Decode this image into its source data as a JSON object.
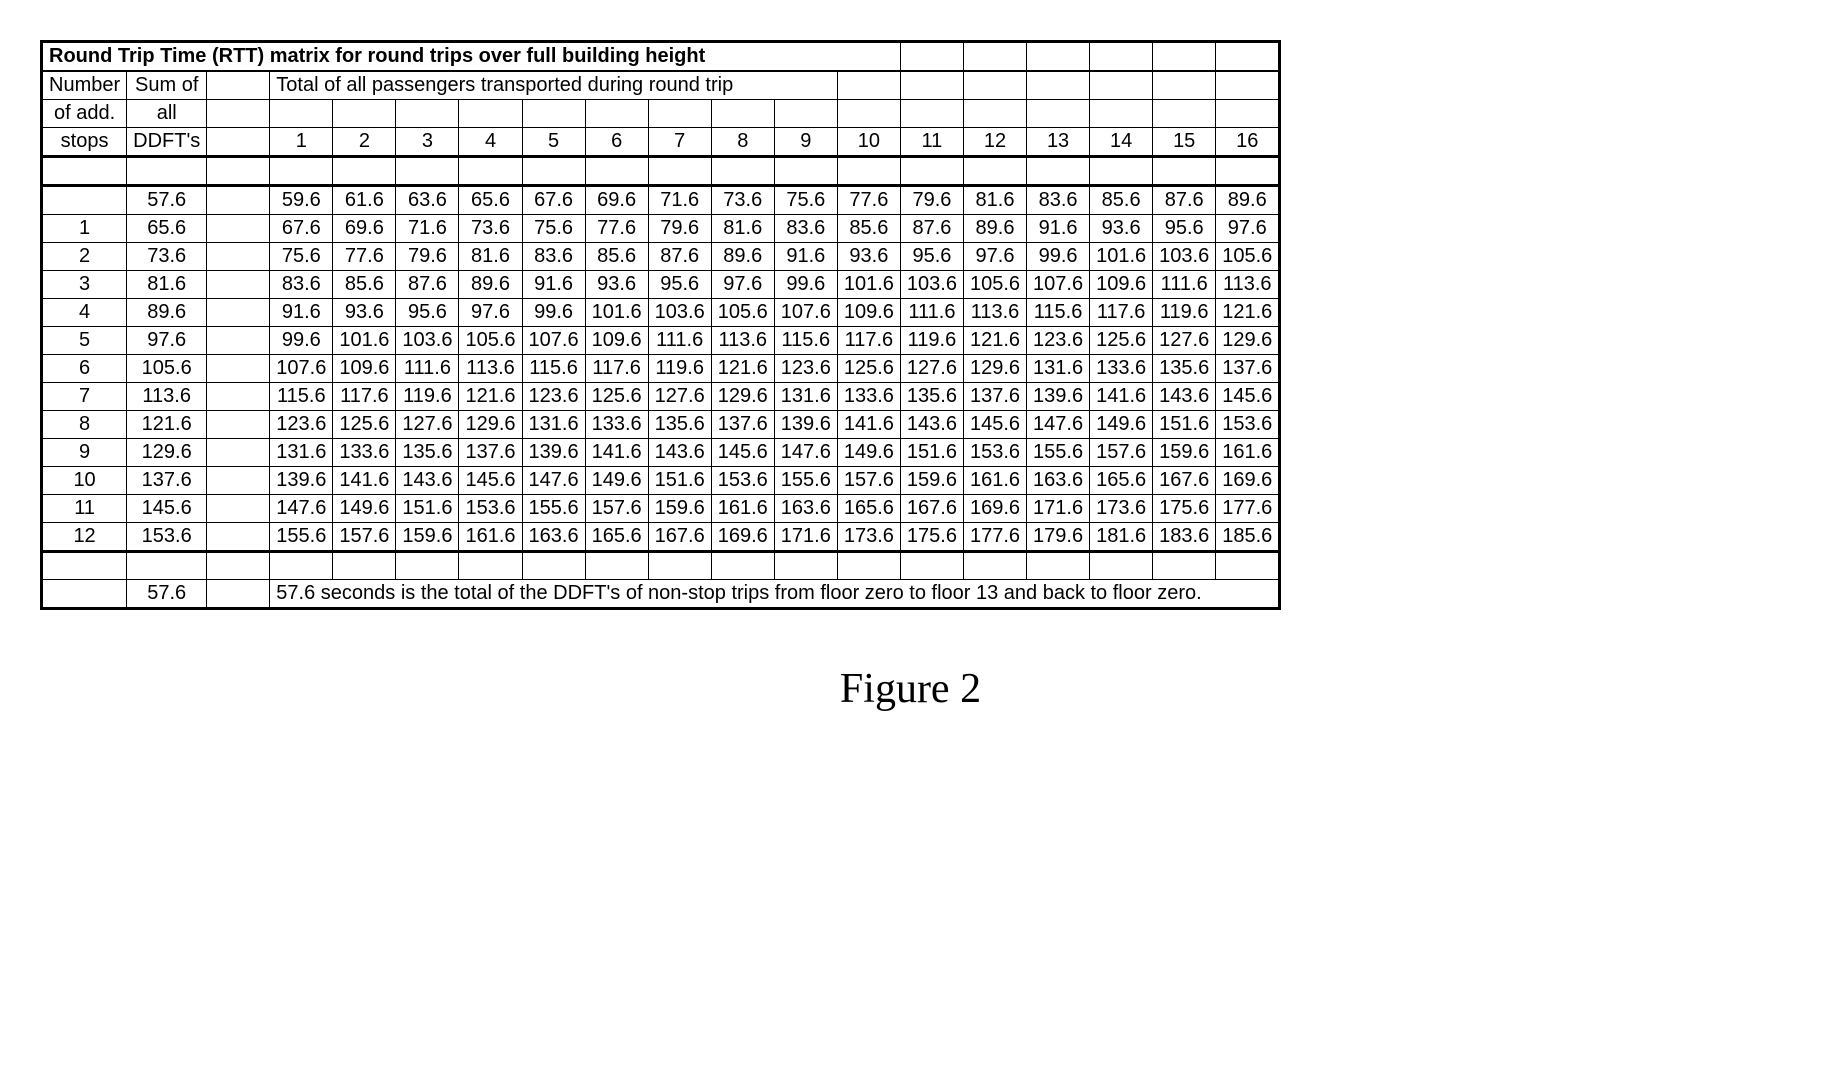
{
  "chart_data": {
    "type": "table",
    "title": "Round Trip Time (RTT) matrix for round trips over full building height",
    "col_header_1": "Number",
    "col_header_2": "Sum of",
    "col_header_3": "Total of all passengers transported during round trip",
    "col_sub_1": "of add.",
    "col_sub_2": "all",
    "col_sub_3": "stops",
    "col_sub_4": "DDFT's",
    "passenger_cols": [
      "1",
      "2",
      "3",
      "4",
      "5",
      "6",
      "7",
      "8",
      "9",
      "10",
      "11",
      "12",
      "13",
      "14",
      "15",
      "16"
    ],
    "rows": [
      {
        "stops": "",
        "ddft": "57.6",
        "vals": [
          "59.6",
          "61.6",
          "63.6",
          "65.6",
          "67.6",
          "69.6",
          "71.6",
          "73.6",
          "75.6",
          "77.6",
          "79.6",
          "81.6",
          "83.6",
          "85.6",
          "87.6",
          "89.6"
        ]
      },
      {
        "stops": "1",
        "ddft": "65.6",
        "vals": [
          "67.6",
          "69.6",
          "71.6",
          "73.6",
          "75.6",
          "77.6",
          "79.6",
          "81.6",
          "83.6",
          "85.6",
          "87.6",
          "89.6",
          "91.6",
          "93.6",
          "95.6",
          "97.6"
        ]
      },
      {
        "stops": "2",
        "ddft": "73.6",
        "vals": [
          "75.6",
          "77.6",
          "79.6",
          "81.6",
          "83.6",
          "85.6",
          "87.6",
          "89.6",
          "91.6",
          "93.6",
          "95.6",
          "97.6",
          "99.6",
          "101.6",
          "103.6",
          "105.6"
        ]
      },
      {
        "stops": "3",
        "ddft": "81.6",
        "vals": [
          "83.6",
          "85.6",
          "87.6",
          "89.6",
          "91.6",
          "93.6",
          "95.6",
          "97.6",
          "99.6",
          "101.6",
          "103.6",
          "105.6",
          "107.6",
          "109.6",
          "111.6",
          "113.6"
        ]
      },
      {
        "stops": "4",
        "ddft": "89.6",
        "vals": [
          "91.6",
          "93.6",
          "95.6",
          "97.6",
          "99.6",
          "101.6",
          "103.6",
          "105.6",
          "107.6",
          "109.6",
          "111.6",
          "113.6",
          "115.6",
          "117.6",
          "119.6",
          "121.6"
        ]
      },
      {
        "stops": "5",
        "ddft": "97.6",
        "vals": [
          "99.6",
          "101.6",
          "103.6",
          "105.6",
          "107.6",
          "109.6",
          "111.6",
          "113.6",
          "115.6",
          "117.6",
          "119.6",
          "121.6",
          "123.6",
          "125.6",
          "127.6",
          "129.6"
        ]
      },
      {
        "stops": "6",
        "ddft": "105.6",
        "vals": [
          "107.6",
          "109.6",
          "111.6",
          "113.6",
          "115.6",
          "117.6",
          "119.6",
          "121.6",
          "123.6",
          "125.6",
          "127.6",
          "129.6",
          "131.6",
          "133.6",
          "135.6",
          "137.6"
        ]
      },
      {
        "stops": "7",
        "ddft": "113.6",
        "vals": [
          "115.6",
          "117.6",
          "119.6",
          "121.6",
          "123.6",
          "125.6",
          "127.6",
          "129.6",
          "131.6",
          "133.6",
          "135.6",
          "137.6",
          "139.6",
          "141.6",
          "143.6",
          "145.6"
        ]
      },
      {
        "stops": "8",
        "ddft": "121.6",
        "vals": [
          "123.6",
          "125.6",
          "127.6",
          "129.6",
          "131.6",
          "133.6",
          "135.6",
          "137.6",
          "139.6",
          "141.6",
          "143.6",
          "145.6",
          "147.6",
          "149.6",
          "151.6",
          "153.6"
        ]
      },
      {
        "stops": "9",
        "ddft": "129.6",
        "vals": [
          "131.6",
          "133.6",
          "135.6",
          "137.6",
          "139.6",
          "141.6",
          "143.6",
          "145.6",
          "147.6",
          "149.6",
          "151.6",
          "153.6",
          "155.6",
          "157.6",
          "159.6",
          "161.6"
        ]
      },
      {
        "stops": "10",
        "ddft": "137.6",
        "vals": [
          "139.6",
          "141.6",
          "143.6",
          "145.6",
          "147.6",
          "149.6",
          "151.6",
          "153.6",
          "155.6",
          "157.6",
          "159.6",
          "161.6",
          "163.6",
          "165.6",
          "167.6",
          "169.6"
        ]
      },
      {
        "stops": "11",
        "ddft": "145.6",
        "vals": [
          "147.6",
          "149.6",
          "151.6",
          "153.6",
          "155.6",
          "157.6",
          "159.6",
          "161.6",
          "163.6",
          "165.6",
          "167.6",
          "169.6",
          "171.6",
          "173.6",
          "175.6",
          "177.6"
        ]
      },
      {
        "stops": "12",
        "ddft": "153.6",
        "vals": [
          "155.6",
          "157.6",
          "159.6",
          "161.6",
          "163.6",
          "165.6",
          "167.6",
          "169.6",
          "171.6",
          "173.6",
          "175.6",
          "177.6",
          "179.6",
          "181.6",
          "183.6",
          "185.6"
        ]
      }
    ],
    "note_value": "57.6",
    "note_text": "57.6 seconds is the total of the DDFT's of non-stop trips from floor zero to floor 13 and back to floor zero."
  },
  "figure_caption": "Figure 2"
}
